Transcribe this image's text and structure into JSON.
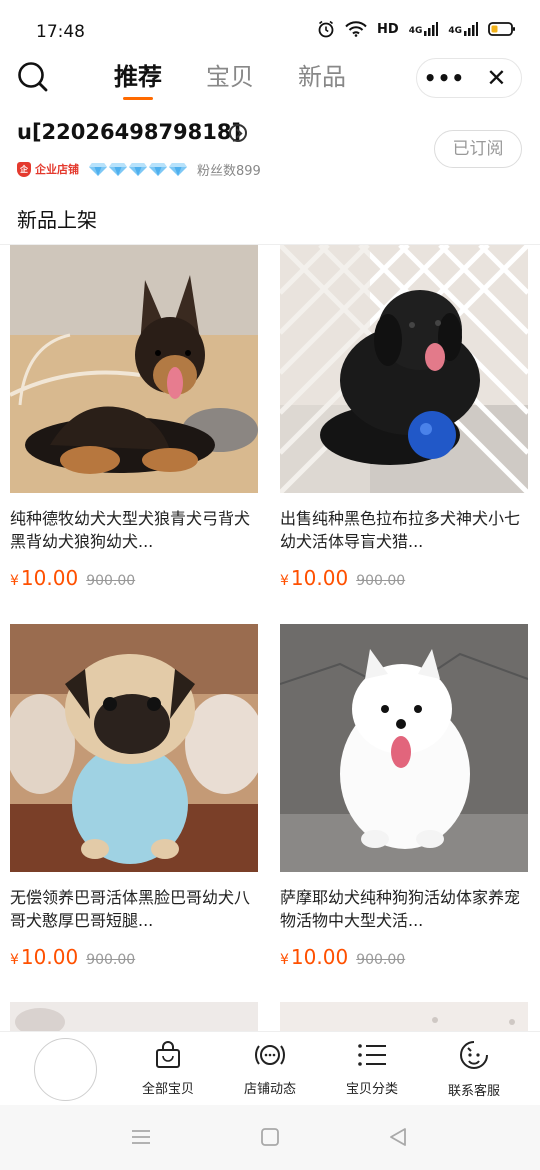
{
  "status_bar": {
    "time": "17:48",
    "network": "HD",
    "signal1": "4G",
    "signal2": "4G"
  },
  "nav": {
    "tabs": [
      {
        "label": "推荐",
        "active": true
      },
      {
        "label": "宝贝",
        "active": false
      },
      {
        "label": "新品",
        "active": false
      }
    ],
    "more_label": "•••",
    "close_label": "✕"
  },
  "shop": {
    "name": "u[2202649879818]",
    "enterprise_label": "企业店铺",
    "diamond_count": 5,
    "fans_label": "粉丝数899",
    "subscribe_label": "已订阅",
    "section_title": "新品上架"
  },
  "products": [
    {
      "title": "纯种德牧幼犬大型犬狼青犬弓背犬黑背幼犬狼狗幼犬...",
      "currency": "¥",
      "price": "10.00",
      "original_price": "900.00"
    },
    {
      "title": "出售纯种黑色拉布拉多犬神犬小七幼犬活体导盲犬猎...",
      "currency": "¥",
      "price": "10.00",
      "original_price": "900.00"
    },
    {
      "title": "无偿领养巴哥活体黑脸巴哥幼犬八哥犬憨厚巴哥短腿...",
      "currency": "¥",
      "price": "10.00",
      "original_price": "900.00"
    },
    {
      "title": "萨摩耶幼犬纯种狗狗活幼体家养宠物活物中大型犬活...",
      "currency": "¥",
      "price": "10.00",
      "original_price": "900.00"
    }
  ],
  "bottom_bar": {
    "items": [
      {
        "label": "全部宝贝",
        "icon": "shopping-bag-icon"
      },
      {
        "label": "店铺动态",
        "icon": "broadcast-icon"
      },
      {
        "label": "宝贝分类",
        "icon": "list-icon"
      },
      {
        "label": "联系客服",
        "icon": "customer-service-icon"
      }
    ]
  },
  "colors": {
    "accent": "#ff6a00",
    "price": "#ff5000",
    "enterprise": "#e43a2e"
  }
}
